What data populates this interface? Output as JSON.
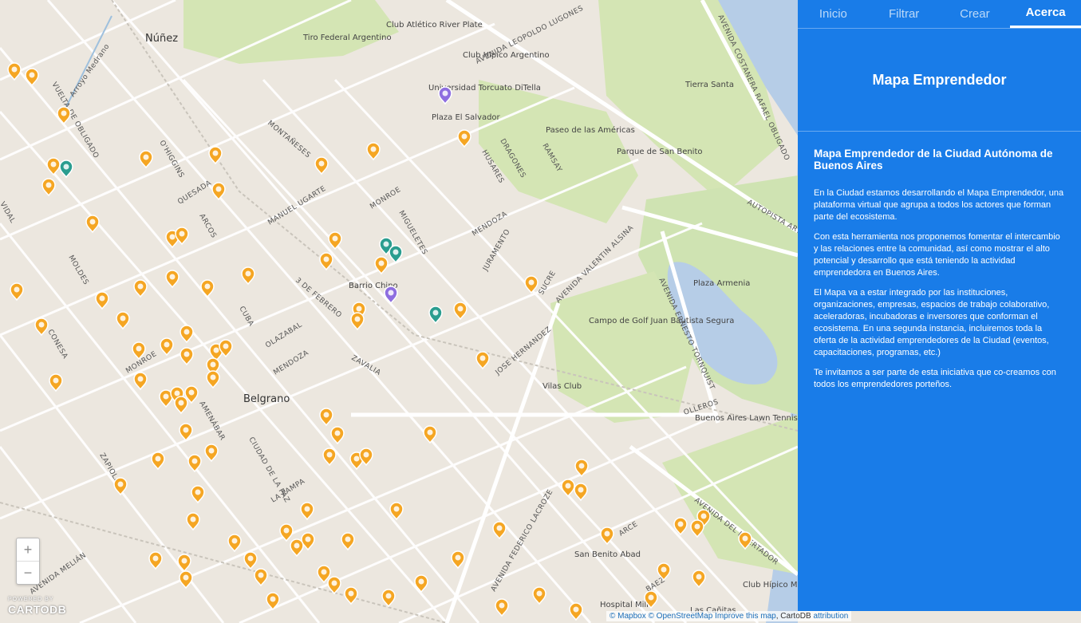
{
  "map": {
    "colors": {
      "land": "#ece7df",
      "park": "#d4e5b4",
      "water": "#b6cde7",
      "road": "#ffffff",
      "block": "#e3ddd4"
    },
    "places": {
      "nunez": "Núñez",
      "belgrano": "Belgrano",
      "barrio_chino": "Barrio Chino",
      "tiro_federal": "Tiro Federal Argentino",
      "club_atletico": "Club Atlético River Plate",
      "club_hipico": "Club Hípico Argentino",
      "universidad": "Universidad Torcuato DiTella",
      "plaza_salvador": "Plaza El Salvador",
      "paseo_americas": "Paseo de las Américas",
      "parque_san_benito": "Parque de San Benito",
      "tierra_santa": "Tierra Santa",
      "plaza_armenia": "Plaza Armenia",
      "campo_golf": "Campo de Golf Juan Bautista Segura",
      "vilas_club": "Vilas Club",
      "lawn_tennis": "Buenos Aires Lawn Tennis Club",
      "san_benito_abad": "San Benito Abad",
      "club_hipico_militar": "Club Hípico Militar",
      "hospital_militar": "Hospital Milit",
      "las_canitas": "Las Cañitas"
    },
    "streets": {
      "av_costanera": "AVENIDA COSTANERA RAFAEL OBLIGADO",
      "av_lugones": "AVENIDA LEOPOLDO LUGONES",
      "autopista": "AUTOPISTA ARTURO",
      "av_alsina": "AVENIDA VALENTIN ALSINA",
      "av_tornquist": "AVENIDA ERNESTO TORNQUIST",
      "av_libertador": "AVENIDA DEL LIBERTADOR",
      "av_lacroze": "AVENIDA FEDERICO LACROZE",
      "av_melian": "AVENIDA MELIÁN",
      "monroe": "MONROE",
      "arcos": "ARCOS",
      "cuba": "CUBA",
      "mendoza": "MENDOZA",
      "olazabal": "OLAZABAL",
      "zavalia": "ZAVALIA",
      "amenabar": "AMENÁBAR",
      "vuelta_obligado": "VUELTA DE OBLIGADO",
      "ciudad_paz": "CIUDAD DE LA PAZ",
      "tres_febrero": "3 DE FEBRERO",
      "ohiggins": "O'HIGGINS",
      "montaneses": "MONTAÑESES",
      "migueletes": "MIGUELETES",
      "ramsay": "RAMSAY",
      "dragones": "DRAGONES",
      "husares": "HUSARES",
      "la_pampa": "LA PAMPA",
      "olleros": "OLLEROS",
      "conesa": "CONESA",
      "zapiola": "ZAPIOLA",
      "moldes": "MOLDES",
      "vidal": "VIDAL",
      "juramento": "JURAMENTO",
      "sucre": "SUCRE",
      "quesada": "QUESADA",
      "ugarte": "MANUEL UGARTE",
      "jose_hernandez": "JOSE HERNANDEZ",
      "arce": "ARCE",
      "baez": "BAEZ",
      "arroyo": "Arroyo Medrano"
    },
    "markers": {
      "orange": "#f5a623",
      "teal": "#2a9d8f",
      "purple": "#8e6ee0"
    }
  },
  "zoom": {
    "in": "+",
    "out": "−"
  },
  "logo": {
    "small": "POWERED BY",
    "big": "CARTODB"
  },
  "attribution": {
    "mapbox": "© Mapbox",
    "osm": "© OpenStreetMap",
    "improve": "Improve this map",
    "cartodb": ", CartoDB",
    "attr": "attribution"
  },
  "panel": {
    "tabs": [
      "Inicio",
      "Filtrar",
      "Crear",
      "Acerca"
    ],
    "active_tab": "Acerca",
    "title": "Mapa Emprendedor",
    "subtitle": "Mapa Emprendedor de la Ciudad Autónoma de Buenos Aires",
    "paragraphs": [
      "En la Ciudad estamos desarrollando el Mapa Emprendedor, una plataforma virtual que agrupa a todos los actores que forman parte del ecosistema.",
      "Con esta herramienta nos proponemos fomentar el intercambio y las relaciones entre la comunidad, así como mostrar el alto potencial y desarrollo que está teniendo la actividad emprendedora en Buenos Aires.",
      "El Mapa va a estar integrado por las instituciones, organizaciones, empresas, espacios de trabajo colaborativo, aceleradoras, incubadoras e inversores que conforman el ecosistema. En una segunda instancia, incluiremos toda la oferta de la actividad emprendedores de la Ciudad (eventos, capacitaciones, programas, etc.)",
      "Te invitamos a ser parte de esta iniciativa que co-creamos con todos los emprendedores porteños."
    ]
  }
}
